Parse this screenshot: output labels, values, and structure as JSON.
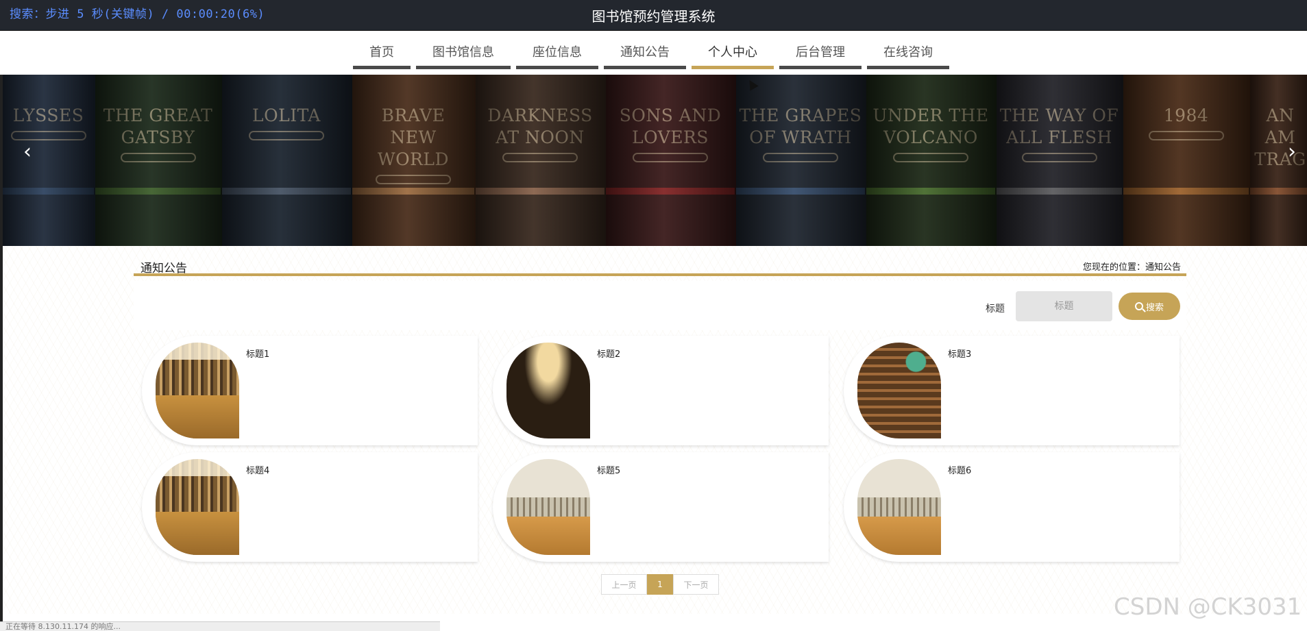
{
  "overlay": {
    "text": "搜索：步进 5 秒(关键帧) / 00:00:20(6%)"
  },
  "header": {
    "title": "图书馆预约管理系统"
  },
  "nav": {
    "items": [
      {
        "label": "首页"
      },
      {
        "label": "图书馆信息"
      },
      {
        "label": "座位信息"
      },
      {
        "label": "通知公告"
      },
      {
        "label": "个人中心"
      },
      {
        "label": "后台管理"
      },
      {
        "label": "在线咨询"
      }
    ],
    "active": "个人中心"
  },
  "banner": {
    "books": [
      {
        "title": "LYSSES"
      },
      {
        "title": "THE GREAT\nGATSBY"
      },
      {
        "title": "LOLITA"
      },
      {
        "title": "BRAVE\nNEW WORLD"
      },
      {
        "title": "DARKNESS\nAT NOON"
      },
      {
        "title": "SONS AND\nLOVERS"
      },
      {
        "title": "THE GRAPES\nOF WRATH"
      },
      {
        "title": "UNDER THE\nVOLCANO"
      },
      {
        "title": "THE WAY OF\nALL FLESH"
      },
      {
        "title": "1984"
      },
      {
        "title": "AN AM\nTRAG"
      }
    ],
    "prev_icon": "chevron-left-icon",
    "next_icon": "chevron-right-icon",
    "prev_glyph": "‹",
    "next_glyph": "›"
  },
  "section": {
    "title": "通知公告",
    "breadcrumb": "您现在的位置：通知公告"
  },
  "search": {
    "label": "标题",
    "placeholder": "标题",
    "button_label": "搜索"
  },
  "notices": [
    {
      "title": "标题1"
    },
    {
      "title": "标题2"
    },
    {
      "title": "标题3"
    },
    {
      "title": "标题4"
    },
    {
      "title": "标题5"
    },
    {
      "title": "标题6"
    }
  ],
  "pagination": {
    "prev": "上一页",
    "current": "1",
    "next": "下一页"
  },
  "watermark": "CSDN @CK3031",
  "statusbar": {
    "text": "正在等待 8.130.11.174 的响应..."
  },
  "colors": {
    "accent": "#c6a457",
    "topbar": "#23272e",
    "overlay_text": "#5b8dff"
  }
}
